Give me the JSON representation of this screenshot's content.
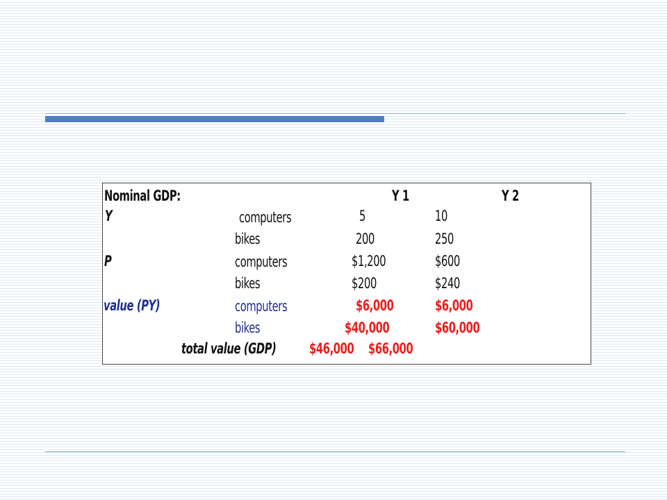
{
  "table": {
    "title": "Nominal GDP:",
    "col_y1": "Y 1",
    "col_y2": "Y 2",
    "rows": [
      {
        "group": "Y",
        "item": "computers",
        "y1": "5",
        "y2": "10"
      },
      {
        "group": "",
        "item": "bikes",
        "y1": "200",
        "y2": "250"
      },
      {
        "group": "P",
        "item": "computers",
        "y1": "$1,200",
        "y2": "$600"
      },
      {
        "group": "",
        "item": "bikes",
        "y1": "$200",
        "y2": "$240"
      },
      {
        "group": "value (PY)",
        "item": "computers",
        "y1": "$6,000",
        "y2": "$6,000"
      },
      {
        "group": "",
        "item": "bikes",
        "y1": "$40,000",
        "y2": "$60,000"
      }
    ],
    "total_label": "total value (GDP)",
    "total_y1": "$46,000",
    "total_y2": "$66,000"
  },
  "colors": {
    "accent_bar": "#4f7fc0",
    "value_label": "#1f2f8f",
    "value_numbers": "#ee1c1c"
  }
}
